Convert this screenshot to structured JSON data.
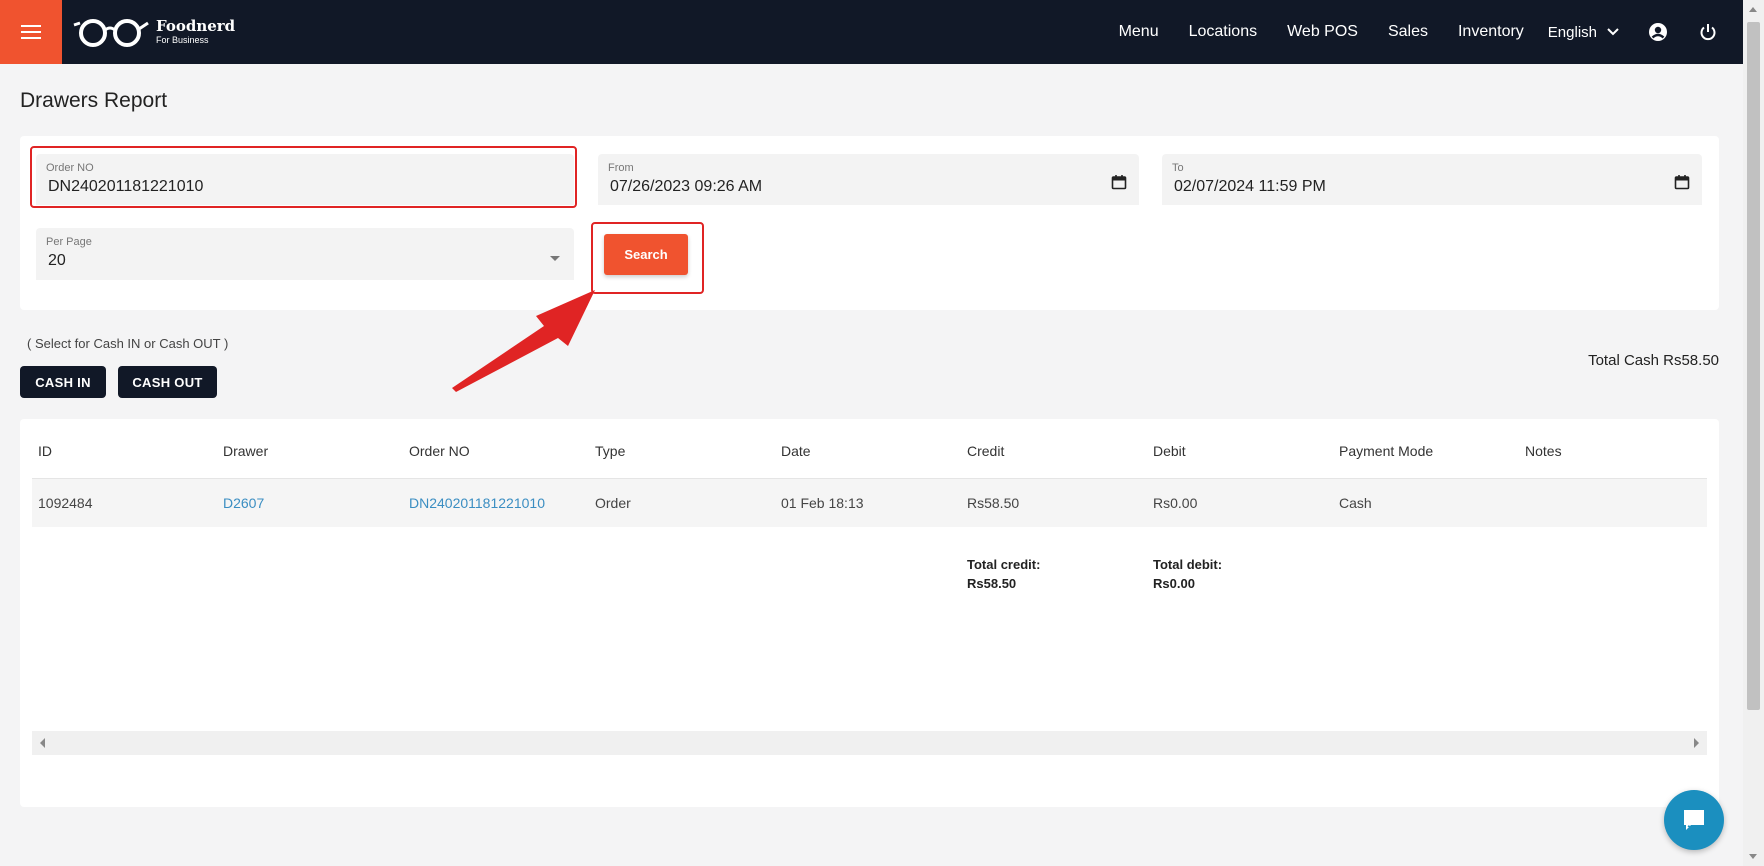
{
  "brand": {
    "name": "Foodnerd",
    "tagline": "For Business"
  },
  "nav": {
    "items": [
      "Menu",
      "Locations",
      "Web POS",
      "Sales",
      "Inventory"
    ],
    "language": "English"
  },
  "page": {
    "title": "Drawers Report"
  },
  "filters": {
    "order_no": {
      "label": "Order NO",
      "value": "DN240201181221010"
    },
    "from": {
      "label": "From",
      "value": "07/26/2023 09:26 AM"
    },
    "to": {
      "label": "To",
      "value": "02/07/2024 11:59 PM"
    },
    "per_page": {
      "label": "Per Page",
      "value": "20"
    },
    "search_label": "Search"
  },
  "cash": {
    "hint": "( Select for Cash IN or Cash OUT )",
    "in_label": "CASH IN",
    "out_label": "CASH OUT",
    "total": "Total Cash Rs58.50"
  },
  "table": {
    "columns": [
      "ID",
      "Drawer",
      "Order NO",
      "Type",
      "Date",
      "Credit",
      "Debit",
      "Payment Mode",
      "Notes"
    ],
    "rows": [
      {
        "id": "1092484",
        "drawer": "D2607",
        "order_no": "DN240201181221010",
        "type": "Order",
        "date": "01 Feb 18:13",
        "credit": "Rs58.50",
        "debit": "Rs0.00",
        "payment_mode": "Cash",
        "notes": ""
      }
    ],
    "totals": {
      "credit_label": "Total credit:",
      "credit_value": "Rs58.50",
      "debit_label": "Total debit:",
      "debit_value": "Rs0.00"
    }
  },
  "colors": {
    "topbar": "#111827",
    "accent": "#f0532f",
    "highlight": "#e02424",
    "link": "#3b8ec2",
    "chat": "#1b8fbf"
  },
  "icons": [
    "menu-icon",
    "glasses-logo-icon",
    "chevron-down-icon",
    "user-circle-icon",
    "power-icon",
    "calendar-icon",
    "dropdown-caret-icon",
    "chat-icon"
  ]
}
